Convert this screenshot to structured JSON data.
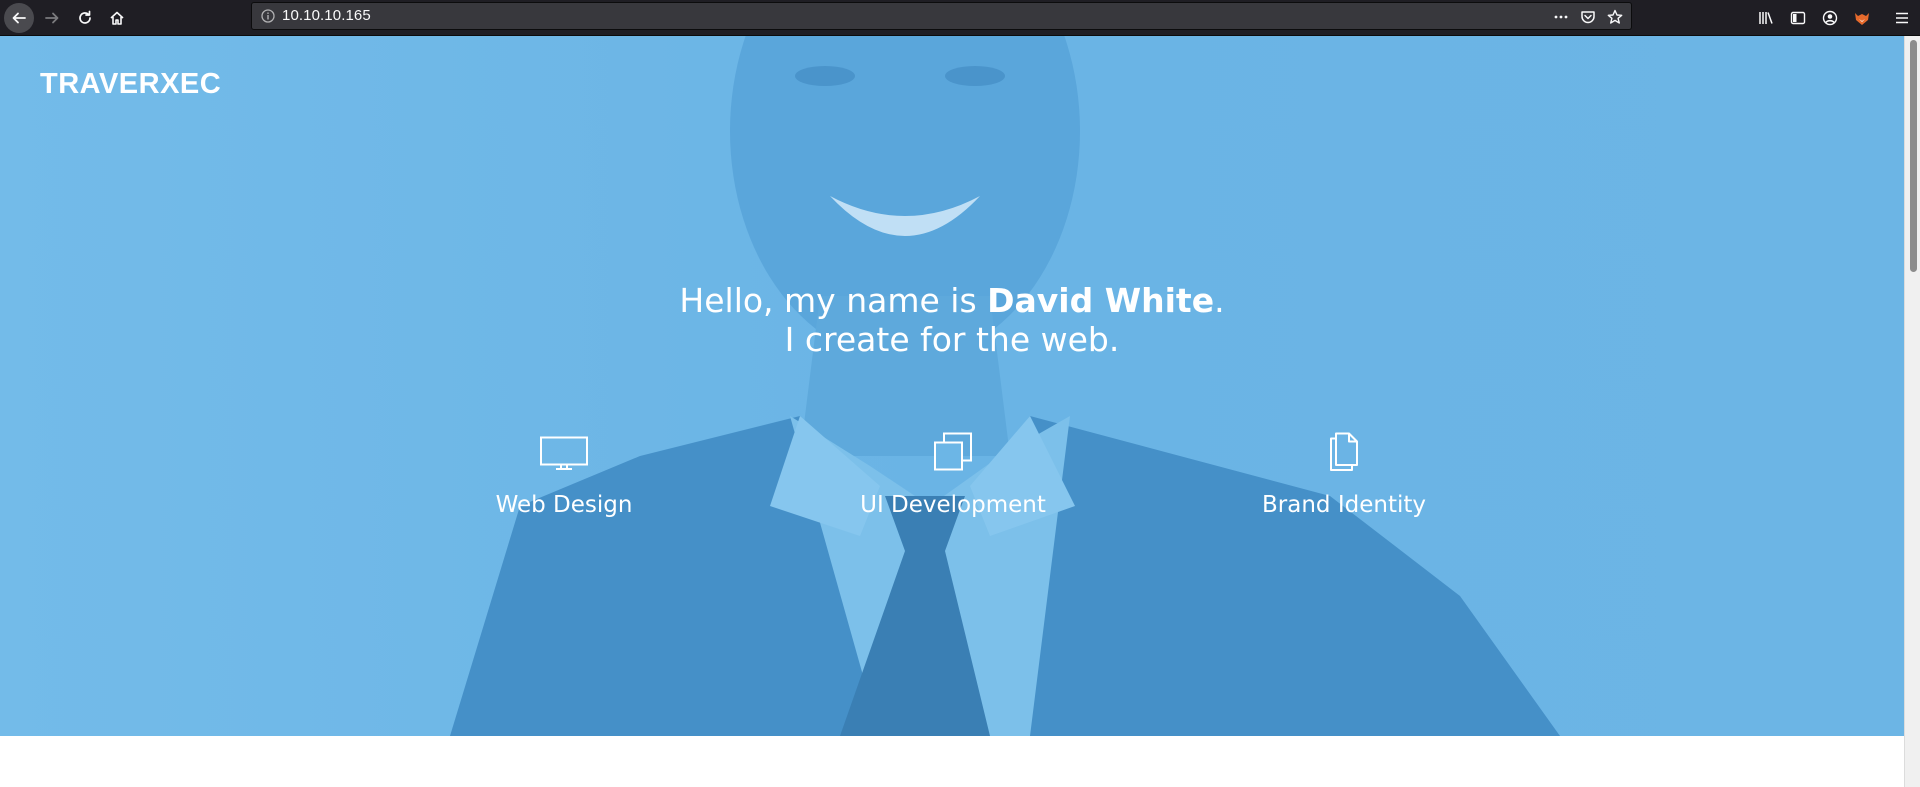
{
  "browser": {
    "url": "10.10.10.165",
    "nav_icons": [
      "back-arrow-icon",
      "forward-arrow-icon",
      "reload-icon",
      "home-icon"
    ],
    "url_icons": [
      "info-icon",
      "page-actions-icon",
      "pocket-icon",
      "bookmark-star-icon"
    ],
    "toolbar_icons": [
      "library-icon",
      "sidebar-icon",
      "account-icon",
      "extension-fox-icon",
      "menu-icon"
    ]
  },
  "page": {
    "brand": "TRAVERXEC",
    "headline": {
      "prefix": "Hello, my name is ",
      "name": "David White",
      "suffix": ".",
      "line2": "I create for the web."
    },
    "services": [
      {
        "label": "Web Design",
        "icon": "monitor-icon"
      },
      {
        "label": "UI Development",
        "icon": "stacked-windows-icon"
      },
      {
        "label": "Brand Identity",
        "icon": "documents-icon"
      }
    ]
  },
  "colors": {
    "hero_overlay": "#6cb6e6",
    "hero_dark": "#3f8fc6",
    "chrome_bg": "#1f1e24",
    "urlbar_bg": "#38383d",
    "text_white": "#ffffff"
  }
}
